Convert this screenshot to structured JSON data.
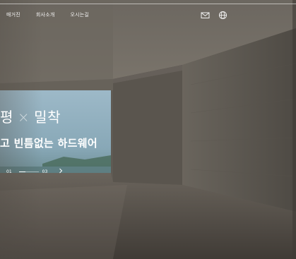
{
  "nav": {
    "items": [
      {
        "label": "매거진"
      },
      {
        "label": "회사소개"
      },
      {
        "label": "오시는길"
      }
    ]
  },
  "header": {
    "icons": [
      "mail-icon",
      "globe-icon"
    ]
  },
  "hero": {
    "headline_part1": "평",
    "headline_separator": "×",
    "headline_part2": "밀착",
    "subline": "고 빈틈없는 하드웨어",
    "pager": {
      "current": "01",
      "total": "03",
      "progress": 0.333,
      "next_icon": "chevron-right-icon"
    }
  },
  "colors": {
    "text": "#ffffff",
    "accent_panel": "#8fb0bf"
  }
}
